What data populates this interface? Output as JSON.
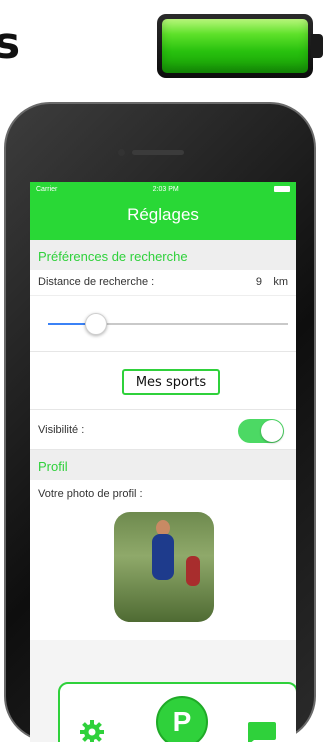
{
  "header": {
    "fragment_text": "s"
  },
  "status_bar": {
    "carrier": "Carrier",
    "time": "2:03 PM"
  },
  "nav": {
    "title": "Réglages"
  },
  "search_section": {
    "header": "Préférences de recherche",
    "distance_label": "Distance de recherche :",
    "distance_value": "9",
    "distance_unit": "km",
    "slider_level_fraction": 0.2
  },
  "sports_button": {
    "label": "Mes sports"
  },
  "visibility": {
    "label": "Visibilité :",
    "enabled": true
  },
  "profile_section": {
    "header": "Profil",
    "photo_label": "Votre photo de profil :"
  },
  "tab_bar": {
    "items": [
      {
        "icon": "gear-icon"
      },
      {
        "icon": "app-logo-icon",
        "glyph": "P"
      },
      {
        "icon": "chat-icon"
      }
    ]
  },
  "colors": {
    "accent": "#29d836",
    "toggle_on": "#4cd964",
    "slider_fill": "#3b82f6"
  },
  "icons": [
    "battery-icon",
    "gear-icon",
    "app-logo-icon",
    "chat-icon"
  ]
}
